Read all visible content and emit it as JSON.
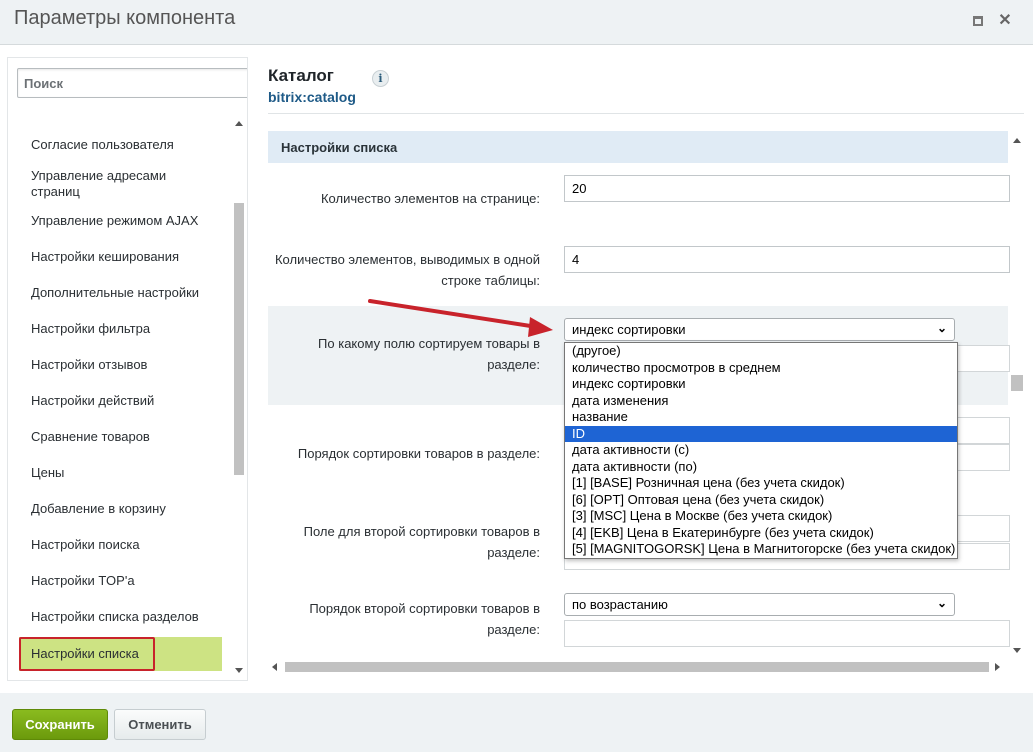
{
  "window": {
    "title": "Параметры компонента"
  },
  "sidebar": {
    "search_placeholder": "Поиск",
    "items": [
      {
        "label": "Согласие пользователя"
      },
      {
        "label": "Управление адресами страниц"
      },
      {
        "label": "Управление режимом AJAX"
      },
      {
        "label": "Настройки кеширования"
      },
      {
        "label": "Дополнительные настройки"
      },
      {
        "label": "Настройки фильтра"
      },
      {
        "label": "Настройки отзывов"
      },
      {
        "label": "Настройки действий"
      },
      {
        "label": "Сравнение товаров"
      },
      {
        "label": "Цены"
      },
      {
        "label": "Добавление в корзину"
      },
      {
        "label": "Настройки поиска"
      },
      {
        "label": "Настройки TOP'а"
      },
      {
        "label": "Настройки списка разделов"
      }
    ],
    "active_item": "Настройки списка"
  },
  "component": {
    "title": "Каталог",
    "code": "bitrix:catalog",
    "info_icon": "i"
  },
  "section": {
    "title": "Настройки списка"
  },
  "fields": {
    "per_page_label": "Количество элементов на странице:",
    "per_page_value": "20",
    "per_row_label": "Количество элементов, выводимых в одной строке таблицы:",
    "per_row_value": "4",
    "sort_field_label": "По какому полю сортируем товары в разделе:",
    "sort_field_value": "индекс сортировки",
    "sort_order_label": "Порядок сортировки товаров в разделе:",
    "sort_field2_label": "Поле для второй сортировки товаров в разделе:",
    "sort_order2_label": "Порядок второй сортировки товаров в разделе:",
    "sort_order2_value": "по возрастанию"
  },
  "dropdown": {
    "options": [
      "(другое)",
      "количество просмотров в среднем",
      "индекс сортировки",
      "дата изменения",
      "название",
      "ID",
      "дата активности (с)",
      "дата активности (по)",
      "[1] [BASE] Розничная цена (без учета скидок)",
      "[6] [OPT] Оптовая цена (без учета скидок)",
      "[3] [MSC] Цена в Москве (без учета скидок)",
      "[4] [EKB] Цена в Екатеринбурге (без учета скидок)",
      "[5] [MAGNITOGORSK] Цена в Магнитогорске (без учета скидок)"
    ],
    "highlighted": "ID"
  },
  "footer": {
    "save_label": "Сохранить",
    "cancel_label": "Отменить"
  },
  "colors": {
    "accent_green": "#8abb1f",
    "active_item_bg": "#cde383",
    "annotation_red": "#c8232b",
    "section_head_bg": "#e0ebf5",
    "dropdown_highlight": "#1e64d4"
  },
  "icons": {
    "maximize": "maximize-icon",
    "close": "close-icon",
    "info": "info-icon",
    "chevron": "chevron-down-icon",
    "annotation_arrow": "red-arrow-annotation"
  }
}
